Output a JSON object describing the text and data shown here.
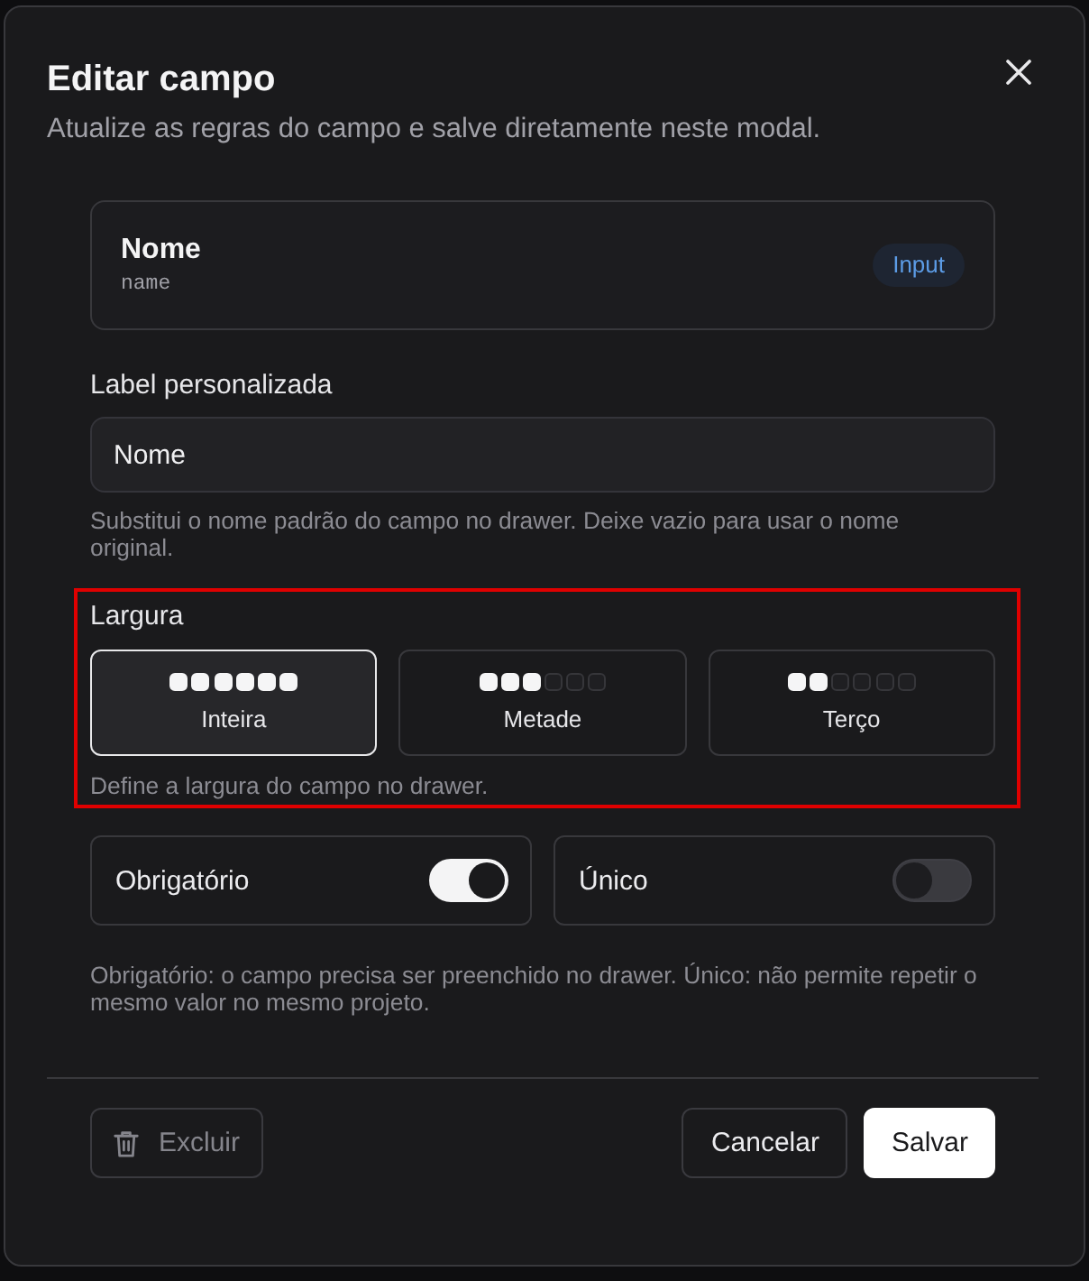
{
  "dialog": {
    "title": "Editar campo",
    "subtitle": "Atualize as regras do campo e salve diretamente neste modal."
  },
  "field_card": {
    "name": "Nome",
    "key": "name",
    "type_badge": "Input"
  },
  "custom_label": {
    "label": "Label personalizada",
    "value": "Nome",
    "help": "Substitui o nome padrão do campo no drawer. Deixe vazio para usar o nome original."
  },
  "width": {
    "highlighted": true,
    "label": "Largura",
    "options": [
      {
        "label": "Inteira",
        "stars": 6,
        "selected": true
      },
      {
        "label": "Metade",
        "stars": 3,
        "selected": false
      },
      {
        "label": "Terço",
        "stars": 2,
        "selected": false
      }
    ],
    "help": "Define a largura do campo no drawer."
  },
  "toggles": [
    {
      "label": "Obrigatório",
      "on": true
    },
    {
      "label": "Único",
      "on": false
    }
  ],
  "toggles_help": "Obrigatório: o campo precisa ser preenchido no drawer. Único: não permite repetir o mesmo valor no mesmo projeto.",
  "footer": {
    "buttons": [
      {
        "kind": "delete",
        "label": "Excluir",
        "disabled": true
      },
      {
        "kind": "secondary",
        "label": "Cancelar",
        "disabled": false
      },
      {
        "kind": "primary",
        "label": "Salvar",
        "disabled": false
      }
    ]
  }
}
